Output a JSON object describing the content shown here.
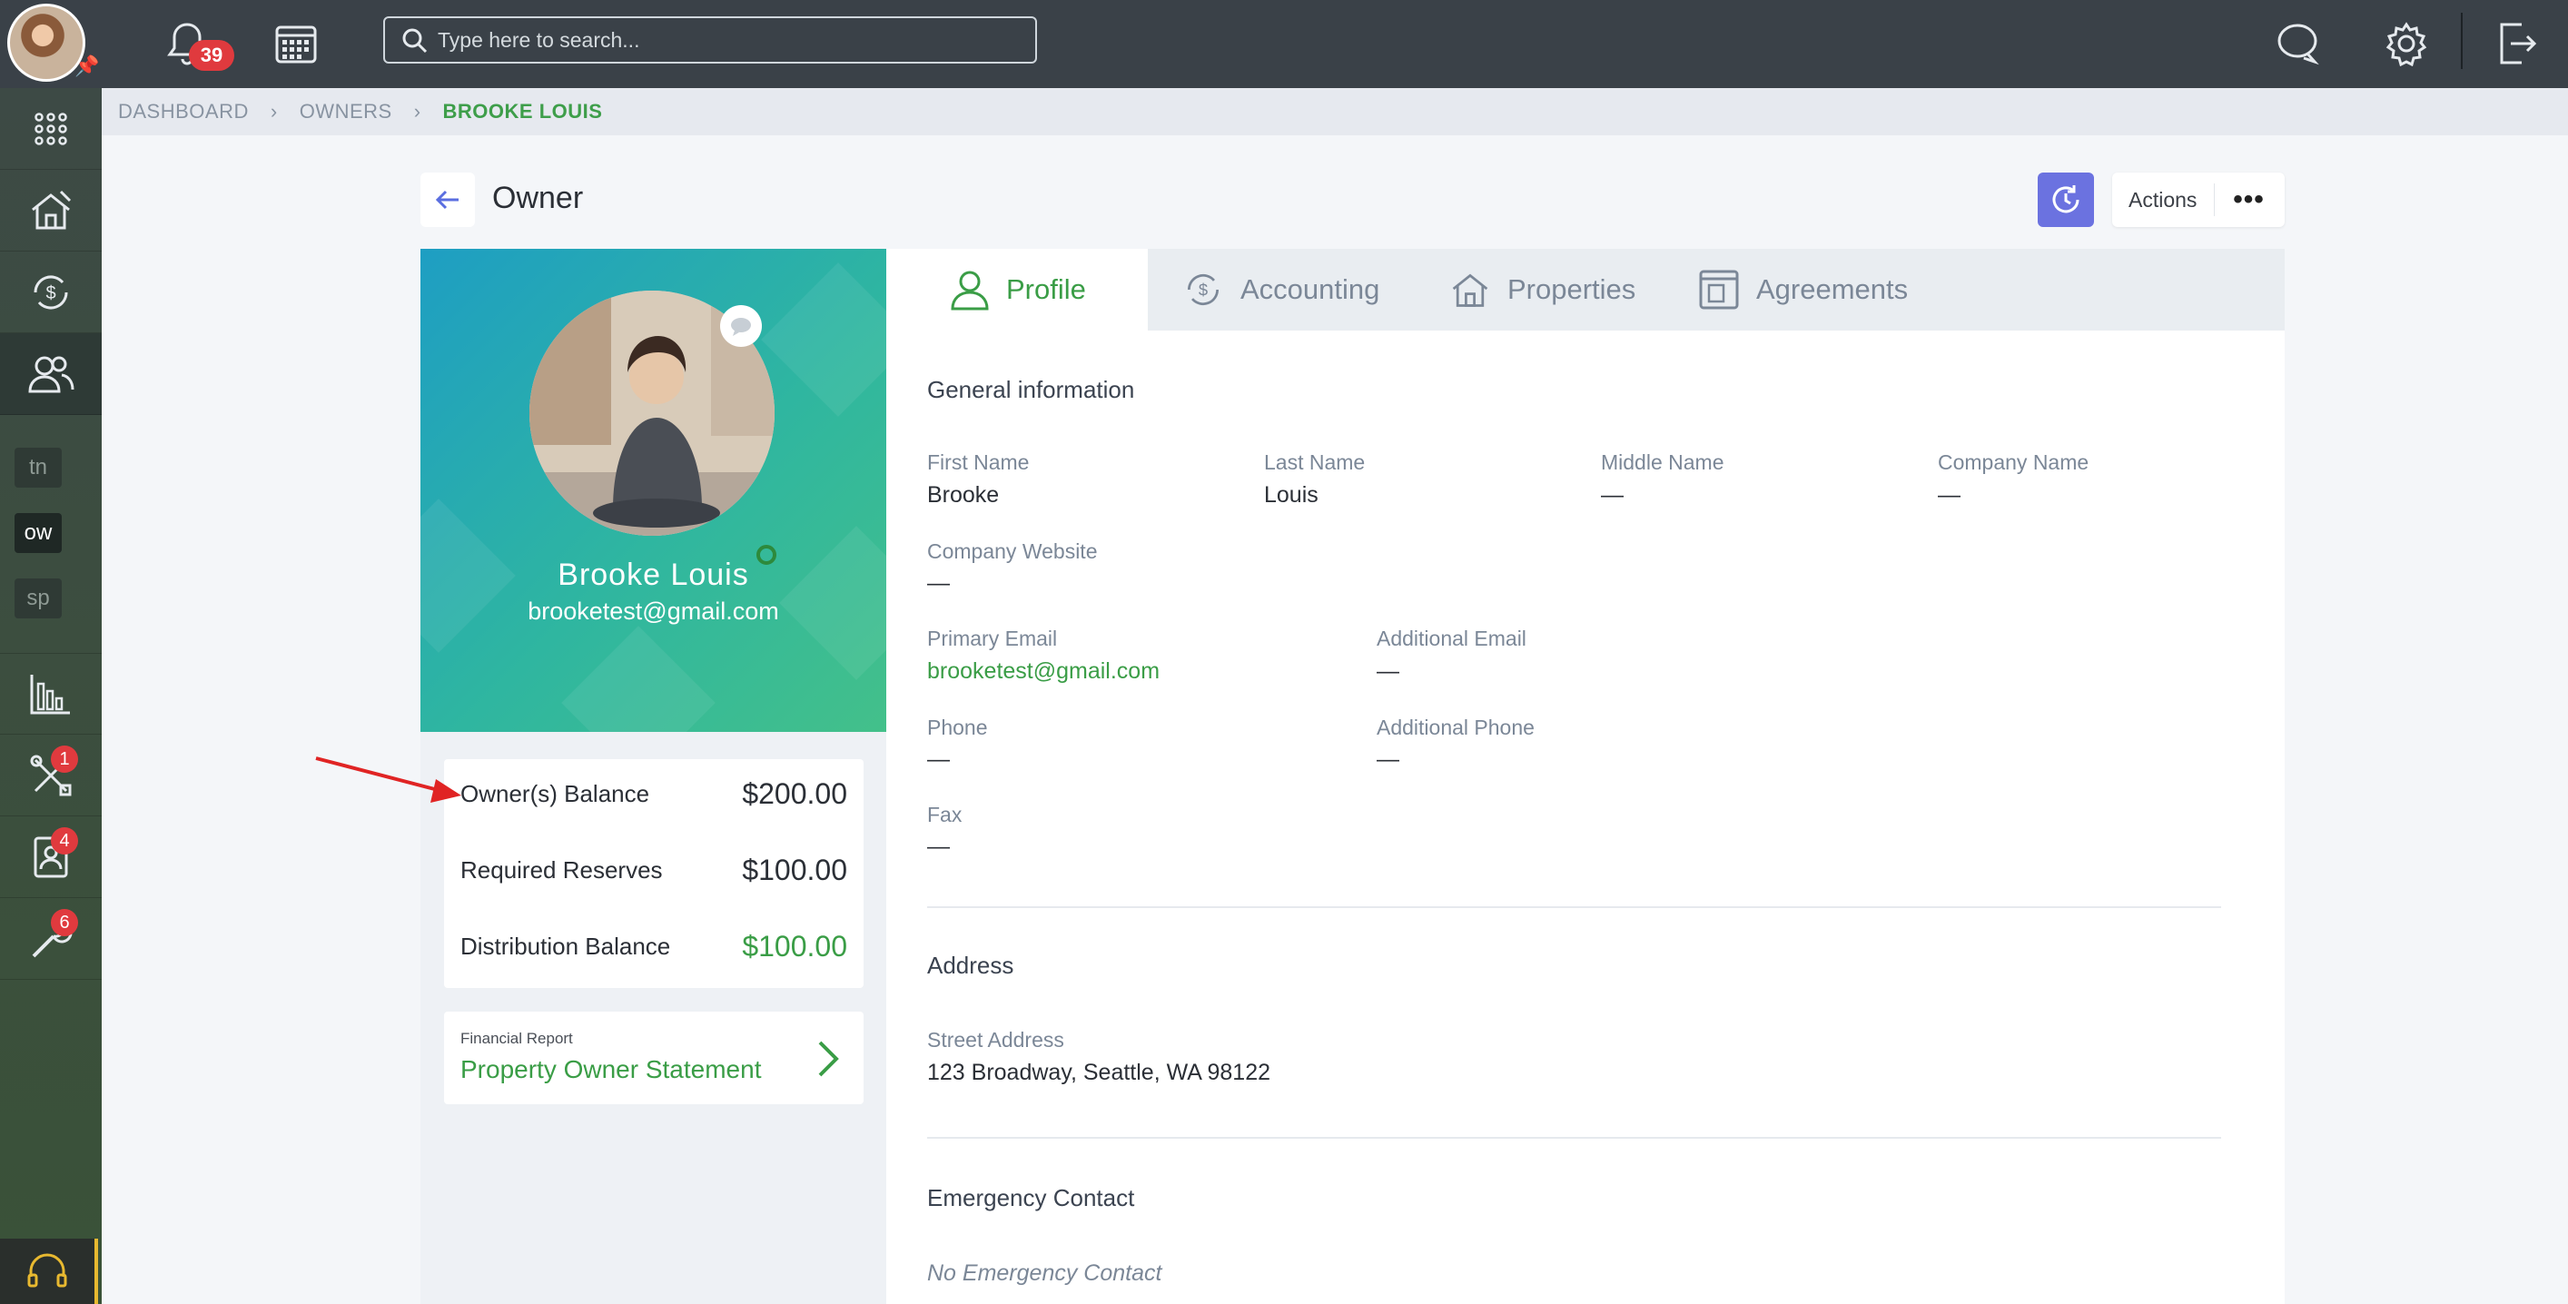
{
  "topbar": {
    "notification_count": "39",
    "search_placeholder": "Type here to search..."
  },
  "sidebar": {
    "workspaces": [
      "tn",
      "ow",
      "sp"
    ],
    "badges": {
      "tools": "1",
      "contacts": "4",
      "maintenance": "6"
    }
  },
  "breadcrumb": {
    "items": [
      "DASHBOARD",
      "OWNERS"
    ],
    "current": "BROOKE LOUIS"
  },
  "page": {
    "title": "Owner",
    "actions_label": "Actions",
    "more_label": "•••"
  },
  "owner": {
    "name": "Brooke Louis",
    "email": "brooketest@gmail.com"
  },
  "balances": [
    {
      "label": "Owner(s) Balance",
      "value": "$200.00"
    },
    {
      "label": "Required Reserves",
      "value": "$100.00"
    },
    {
      "label": "Distribution Balance",
      "value": "$100.00"
    }
  ],
  "report": {
    "caption": "Financial Report",
    "link": "Property Owner Statement"
  },
  "tabs": [
    {
      "label": "Profile",
      "active": true
    },
    {
      "label": "Accounting"
    },
    {
      "label": "Properties"
    },
    {
      "label": "Agreements"
    }
  ],
  "general": {
    "title": "General information",
    "first_name": {
      "label": "First Name",
      "value": "Brooke"
    },
    "last_name": {
      "label": "Last Name",
      "value": "Louis"
    },
    "middle_name": {
      "label": "Middle Name",
      "value": "—"
    },
    "company_name": {
      "label": "Company Name",
      "value": "—"
    },
    "company_website": {
      "label": "Company Website",
      "value": "—"
    },
    "primary_email": {
      "label": "Primary Email",
      "value": "brooketest@gmail.com"
    },
    "additional_email": {
      "label": "Additional Email",
      "value": "—"
    },
    "phone": {
      "label": "Phone",
      "value": "—"
    },
    "additional_phone": {
      "label": "Additional Phone",
      "value": "—"
    },
    "fax": {
      "label": "Fax",
      "value": "—"
    }
  },
  "address": {
    "title": "Address",
    "street_label": "Street Address",
    "street_value": "123 Broadway, Seattle, WA 98122"
  },
  "emergency": {
    "title": "Emergency Contact",
    "empty": "No Emergency Contact"
  },
  "colors": {
    "topbar": "#3a4148",
    "accent_green": "#3a9d46",
    "refresh_button": "#6b72e0",
    "badge_red": "#e03a3e"
  }
}
